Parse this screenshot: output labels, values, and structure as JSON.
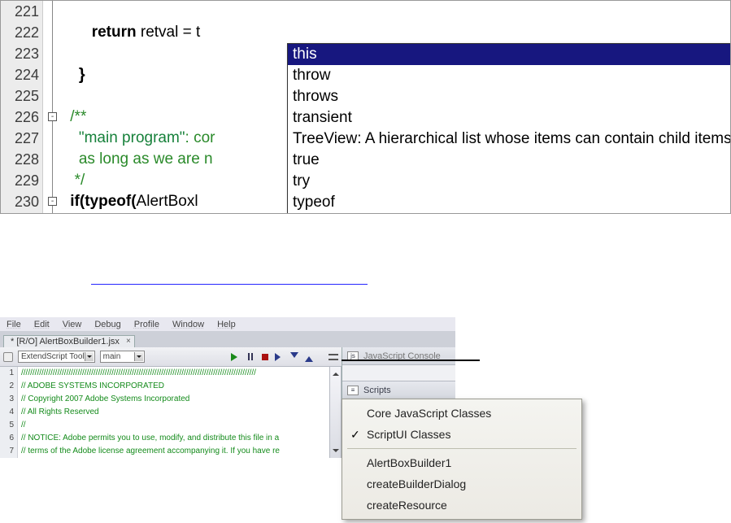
{
  "editor": {
    "lines": [
      "221",
      "222",
      "223",
      "224",
      "225",
      "226",
      "227",
      "228",
      "229",
      "230"
    ],
    "code": {
      "l222_return": "return",
      "l222_rest": " retval = t",
      "l224_brace": "}",
      "l226_cmt": "/**",
      "l227_str": "\"main program\"",
      "l227_cmt": ": cor",
      "l228_cmt": "   as long as we are n",
      "l229_cmt": "*/",
      "l230_if": "if(typeof(",
      "l230_id": "AlertBoxl"
    }
  },
  "autocomplete": {
    "items": [
      "this",
      "throw",
      "throws",
      "transient",
      "TreeView: A hierarchical list whose items can contain child items.",
      "true",
      "try",
      "typeof"
    ],
    "selected_index": 0
  },
  "ide": {
    "menubar": [
      "File",
      "Edit",
      "View",
      "Debug",
      "Profile",
      "Window",
      "Help"
    ],
    "tab_label": "* [R/O] AlertBoxBuilder1.jsx",
    "combos": {
      "target": "ExtendScript Tool",
      "func": "main"
    },
    "right_panel_console": "JavaScript Console",
    "right_panel_scripts": "Scripts",
    "mini_lines": [
      "1",
      "2",
      "3",
      "4",
      "5",
      "6",
      "7"
    ],
    "mini_code": [
      "////////////////////////////////////////////////////////////////////////////////////////////////////////",
      "// ADOBE SYSTEMS INCORPORATED",
      "// Copyright 2007 Adobe Systems Incorporated",
      "// All Rights Reserved",
      "//",
      "// NOTICE:  Adobe permits you to use, modify, and distribute this file in a",
      "// terms of the Adobe license agreement accompanying it. If you have re"
    ]
  },
  "context_menu": {
    "group1": [
      "Core JavaScript Classes",
      "ScriptUI Classes"
    ],
    "checked_index": 1,
    "group2": [
      "AlertBoxBuilder1",
      "createBuilderDialog",
      "createResource"
    ]
  }
}
